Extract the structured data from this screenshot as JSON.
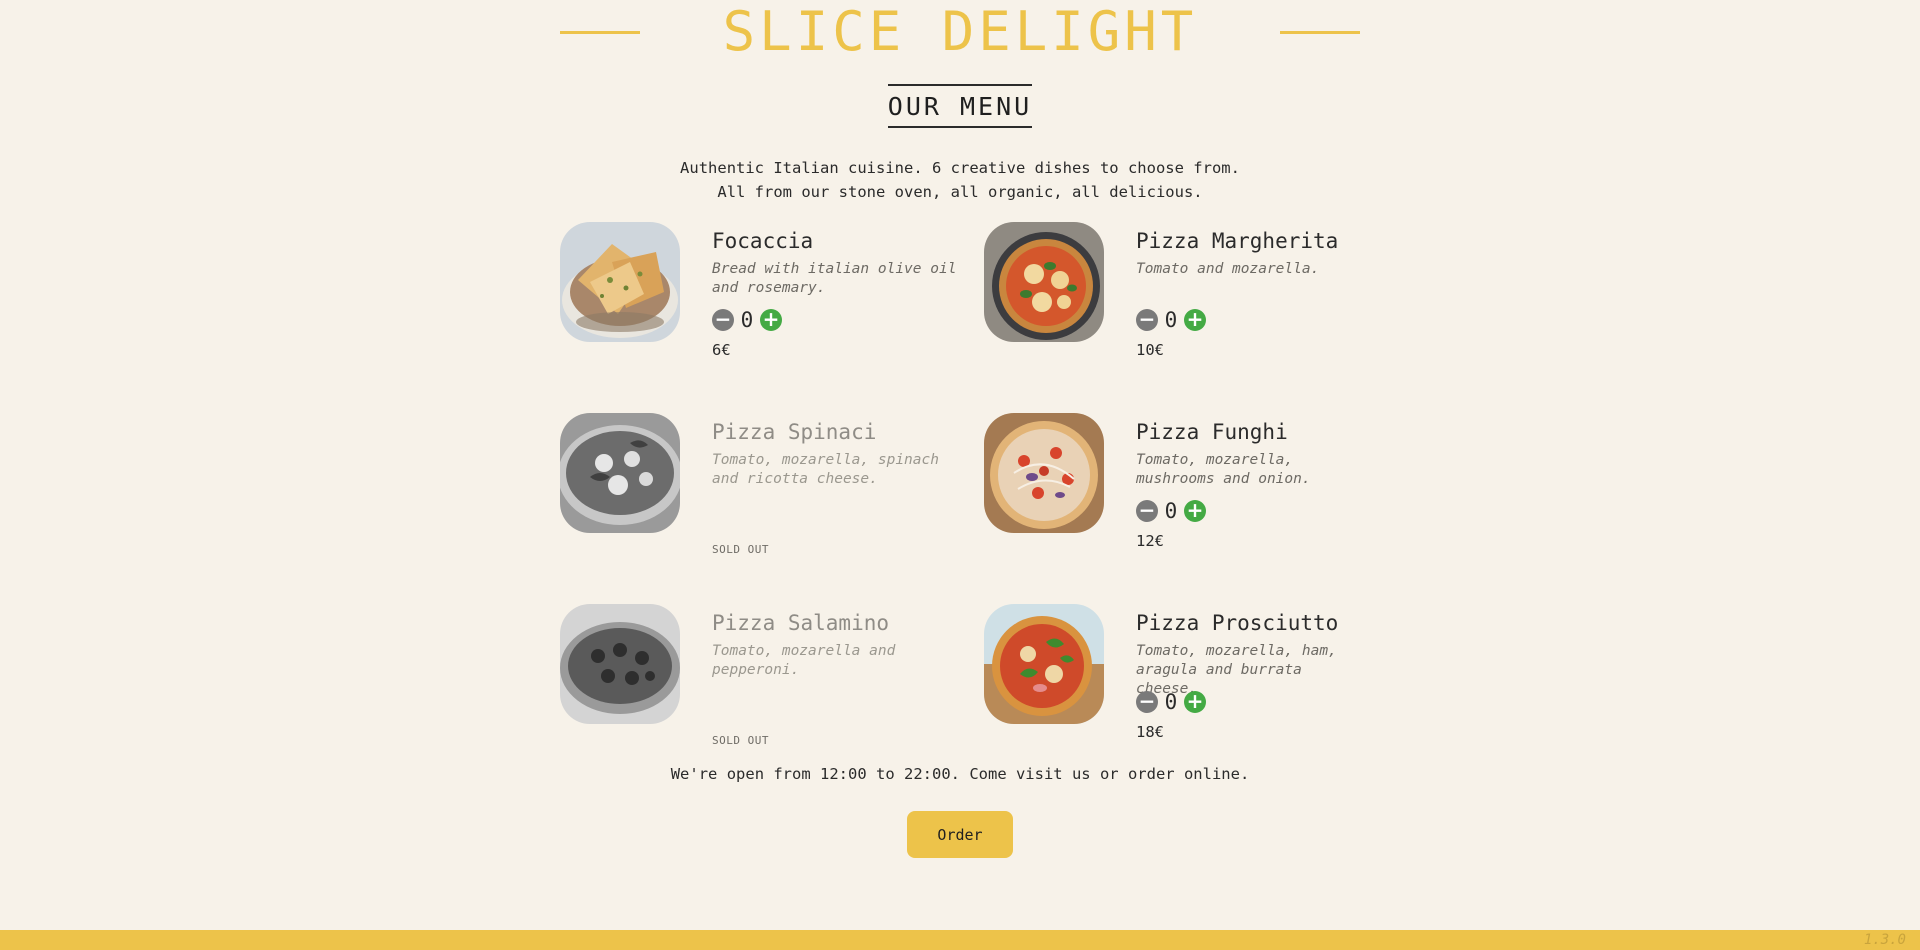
{
  "brand": {
    "title": "SLICE DELIGHT",
    "accent": "#edc34a"
  },
  "menu_heading": "OUR MENU",
  "intro": {
    "line1": "Authentic Italian cuisine. 6 creative dishes to choose from.",
    "line2": "All from our stone oven, all organic, all delicious."
  },
  "items": [
    {
      "name": "Focaccia",
      "description": "Bread with italian olive oil and rosemary.",
      "quantity": "0",
      "price": "6€",
      "sold_out": false
    },
    {
      "name": "Pizza Margherita",
      "description": "Tomato and mozarella.",
      "quantity": "0",
      "price": "10€",
      "sold_out": false
    },
    {
      "name": "Pizza Spinaci",
      "description": "Tomato, mozarella, spinach and ricotta cheese.",
      "status": "SOLD OUT",
      "sold_out": true
    },
    {
      "name": "Pizza Funghi",
      "description": "Tomato, mozarella, mushrooms and onion.",
      "quantity": "0",
      "price": "12€",
      "sold_out": false
    },
    {
      "name": "Pizza Salamino",
      "description": "Tomato, mozarella and pepperoni.",
      "status": "SOLD OUT",
      "sold_out": true
    },
    {
      "name": "Pizza Prosciutto",
      "description": "Tomato, mozarella, ham, aragula and burrata cheese.",
      "quantity": "0",
      "price": "18€",
      "sold_out": false
    }
  ],
  "icons": {
    "decrease": "minus-circle-icon",
    "increase": "plus-circle-icon"
  },
  "hours_text": "We're open from 12:00 to 22:00. Come visit us or order online.",
  "order_label": "Order",
  "version": "1.3.0"
}
